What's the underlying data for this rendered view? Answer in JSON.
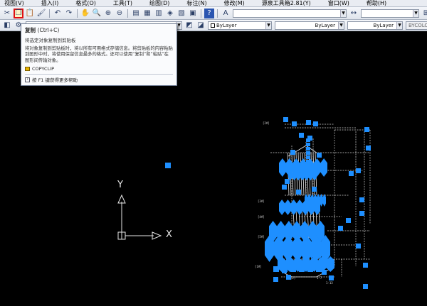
{
  "menubar": {
    "items": [
      "视图(V)",
      "插入(I)",
      "格式(O)",
      "工具(T)",
      "绘图(D)",
      "标注(N)",
      "修改(M)",
      "源泉工具箱2.81(Y)",
      "窗口(W)",
      "帮助(H)"
    ]
  },
  "toolbar1": {
    "text_style_combo": "",
    "dim_style_combo": "",
    "table_style_combo": "",
    "copy_button_label": "复制"
  },
  "toolbar2": {
    "layer_combo": "",
    "color_combo": "ByLayer",
    "linetype_combo": "ByLayer",
    "lineweight_combo": "ByLayer",
    "plotstyle_combo": "BYCOLOR"
  },
  "tooltip": {
    "title": "复制",
    "shortcut": "(Ctrl+C)",
    "subtitle": "将选定对象复制到剪贴板",
    "body": "将对象复制到剪贴板时，将以所有可用格式存储信息。将剪贴板的内容粘贴到图形中时，将使用保留信息最多的格式。还可以使用“复制”和“粘贴”在图形间传输对象。",
    "command": "COPYCLIP",
    "help": "按 F1 键获得更多帮助"
  },
  "ucs": {
    "x_label": "X",
    "y_label": "Y"
  },
  "colors": {
    "canvas_bg": "#000000",
    "selection_grip": "#1e8fff",
    "highlight_border": "#e01010"
  },
  "icons": [
    "cut-icon",
    "copy-icon",
    "paste-icon",
    "match-properties-icon",
    "undo-icon",
    "redo-icon",
    "pan-icon",
    "zoom-realtime-icon",
    "zoom-window-icon",
    "zoom-previous-icon",
    "properties-icon",
    "design-center-icon",
    "tool-palettes-icon",
    "sheet-set-icon",
    "markup-icon",
    "calculator-icon",
    "help-icon",
    "text-style-icon",
    "dim-style-icon",
    "layer-icon",
    "color-icon"
  ]
}
